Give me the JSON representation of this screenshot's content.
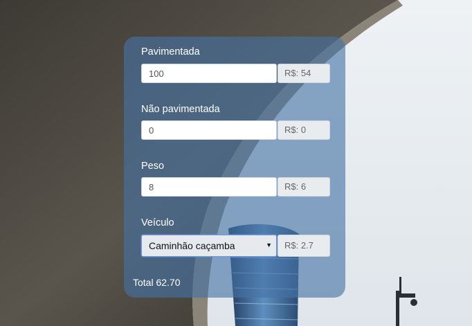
{
  "form": {
    "paved": {
      "label": "Pavimentada",
      "value": "100",
      "cost": "R$: 54"
    },
    "unpaved": {
      "label": "Não pavimentada",
      "value": "0",
      "cost": "R$: 0"
    },
    "weight": {
      "label": "Peso",
      "value": "8",
      "cost": "R$: 6"
    },
    "vehicle": {
      "label": "Veículo",
      "selected": "Caminhão caçamba",
      "cost": "R$: 2.7"
    },
    "total": "Total 62.70"
  },
  "colors": {
    "panel": "#4673a5",
    "label_text": "#ffffff",
    "addon_bg": "#e9ecef",
    "select_border": "#6c9ad6"
  },
  "icons": {
    "select_arrow": "triangle-down"
  }
}
